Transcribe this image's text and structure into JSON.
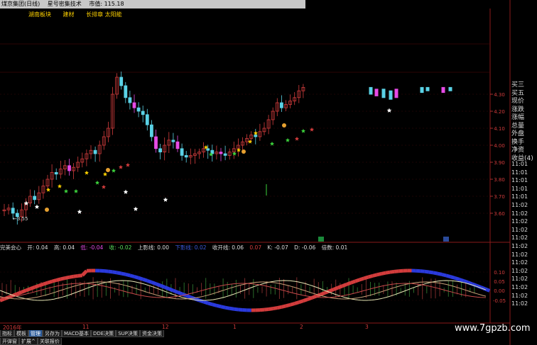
{
  "topbar": {
    "items": [
      "煤京集团(日线)",
      "星号密集技术",
      "市值: 115.18"
    ]
  },
  "tags": [
    "湖南板块",
    "建材",
    "长排章 太阳能"
  ],
  "price_axis": {
    "ticks": [
      "4.30",
      "4.20",
      "4.10",
      "4.00",
      "3.90",
      "3.80",
      "3.70",
      "3.60"
    ]
  },
  "low_label": "←3.55",
  "sub_axis": {
    "ticks": [
      "0.10",
      "0.05",
      "0.00",
      "-0.05"
    ]
  },
  "right_panel": {
    "labels": [
      "买三",
      "买五",
      "现价",
      "涨跌",
      "涨幅",
      "总量",
      "外盘",
      "换手",
      "净资",
      "收益(4)"
    ],
    "times": [
      "11:01",
      "11:01",
      "11:01",
      "11:01",
      "11:01",
      "11:02",
      "11:02",
      "11:02",
      "11:02",
      "11:02",
      "11:02",
      "11:02",
      "11:02",
      "11:02",
      "11:02",
      "11:02",
      "11:02",
      "11:02"
    ]
  },
  "sub_info": {
    "title": "完美会心",
    "open": "开: 0.04",
    "high": "高: 0.04",
    "low": "低: -0.04",
    "close": "收: -0.02",
    "upper": "上影线: 0.00",
    "lower": "下影线: 0.02",
    "open_line": "收开线: 0.06",
    "mid": "0.07",
    "k": "K: -0.07",
    "d": "D: -0.06",
    "mult": "倍数: 0.01"
  },
  "date_bar": {
    "labels": [
      "2016年",
      "11",
      "12",
      "1",
      "2",
      "3"
    ]
  },
  "tabs_row1": [
    "指标",
    "模板",
    "管理",
    "另存为",
    "MACD基本",
    "DDE决策",
    "SUP决策",
    "资金决策"
  ],
  "tabs_row2": [
    "开弹窗",
    "扩展^",
    "关联报价"
  ],
  "watermark": "www.7gpzb.com",
  "colors": {
    "up": "#d23c3c",
    "down": "#5ad2e6",
    "magenta": "#e64be6",
    "gold": "#ffd200"
  }
}
